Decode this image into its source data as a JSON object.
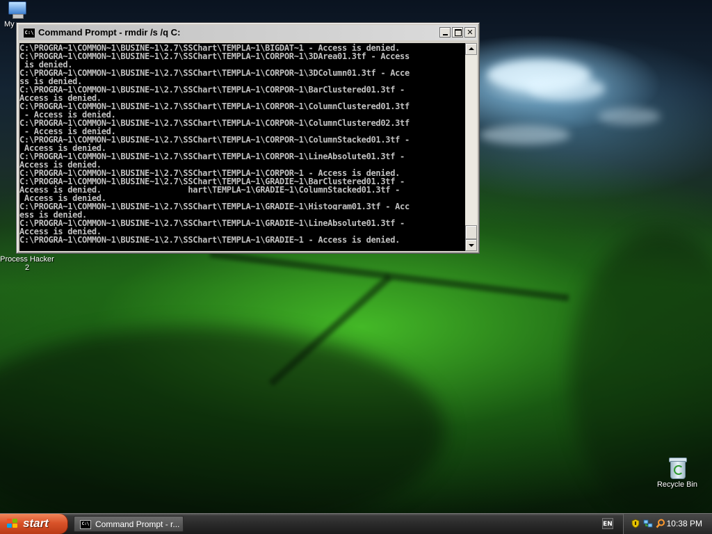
{
  "window": {
    "title": "Command Prompt - rmdir /s /q C:",
    "icon_label": "C:\\",
    "console_lines": [
      "C:\\PROGRA~1\\COMMON~1\\BUSINE~1\\2.7\\SSChart\\TEMPLA~1\\BIGDAT~1 - Access is denied.",
      "C:\\PROGRA~1\\COMMON~1\\BUSINE~1\\2.7\\SSChart\\TEMPLA~1\\CORPOR~1\\3DArea01.3tf - Access",
      " is denied.",
      "C:\\PROGRA~1\\COMMON~1\\BUSINE~1\\2.7\\SSChart\\TEMPLA~1\\CORPOR~1\\3DColumn01.3tf - Acce",
      "ss is denied.",
      "C:\\PROGRA~1\\COMMON~1\\BUSINE~1\\2.7\\SSChart\\TEMPLA~1\\CORPOR~1\\BarClustered01.3tf -",
      "Access is denied.",
      "C:\\PROGRA~1\\COMMON~1\\BUSINE~1\\2.7\\SSChart\\TEMPLA~1\\CORPOR~1\\ColumnClustered01.3tf",
      " - Access is denied.",
      "C:\\PROGRA~1\\COMMON~1\\BUSINE~1\\2.7\\SSChart\\TEMPLA~1\\CORPOR~1\\ColumnClustered02.3tf",
      " - Access is denied.",
      "C:\\PROGRA~1\\COMMON~1\\BUSINE~1\\2.7\\SSChart\\TEMPLA~1\\CORPOR~1\\ColumnStacked01.3tf -",
      " Access is denied.",
      "C:\\PROGRA~1\\COMMON~1\\BUSINE~1\\2.7\\SSChart\\TEMPLA~1\\CORPOR~1\\LineAbsolute01.3tf -",
      "Access is denied.",
      "C:\\PROGRA~1\\COMMON~1\\BUSINE~1\\2.7\\SSChart\\TEMPLA~1\\CORPOR~1 - Access is denied.",
      "C:\\PROGRA~1\\COMMON~1\\BUSINE~1\\2.7\\SSChart\\TEMPLA~1\\GRADIE~1\\BarClustered01.3tf -",
      "Access is denied.                  hart\\TEMPLA~1\\GRADIE~1\\ColumnStacked01.3tf -",
      " Access is denied.",
      "C:\\PROGRA~1\\COMMON~1\\BUSINE~1\\2.7\\SSChart\\TEMPLA~1\\GRADIE~1\\Histogram01.3tf - Acc",
      "ess is denied.",
      "C:\\PROGRA~1\\COMMON~1\\BUSINE~1\\2.7\\SSChart\\TEMPLA~1\\GRADIE~1\\LineAbsolute01.3tf -",
      "Access is denied.",
      "C:\\PROGRA~1\\COMMON~1\\BUSINE~1\\2.7\\SSChart\\TEMPLA~1\\GRADIE~1 - Access is denied."
    ],
    "buttons": {
      "close": "✕"
    }
  },
  "desktop": {
    "icons": [
      {
        "label": "My"
      },
      {
        "label": "Process Hacker 2"
      },
      {
        "label": "Recycle Bin"
      }
    ]
  },
  "taskbar": {
    "start_label": "start",
    "task_label": "Command Prompt - r...",
    "language": "EN",
    "clock": "10:38 PM"
  },
  "colors": {
    "console_text": "#c0c0c0",
    "console_bg": "#000000",
    "start_button": "#d9532a"
  }
}
